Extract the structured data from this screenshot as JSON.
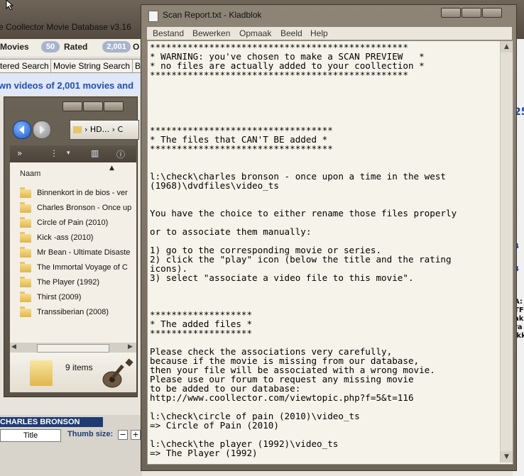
{
  "background_app": {
    "title": "e Coollector Movie Database  v3.16",
    "stats": [
      {
        "label": "Movies",
        "count": "50"
      },
      {
        "label": "Rated",
        "count": "2,001"
      },
      {
        "label": "O"
      }
    ],
    "tabs": [
      "tered Search",
      "Movie String Search",
      "B"
    ],
    "banner_text": "wn videos of 2,001 movies and",
    "bottom_header": "CHARLES BRONSON",
    "title_field_value": "Title",
    "thumb_size_label": "Thumb size:",
    "thumb_minus": "−",
    "thumb_plus": "+",
    "right_strip": [
      "25",
      "4",
      "4",
      "A:",
      "TF",
      "aki",
      "ra",
      "ikk"
    ]
  },
  "explorer": {
    "address": "HD...",
    "address_chevron": "›",
    "address_next": "C",
    "column_header": "Naam",
    "items": [
      "Binnenkort in de bios - ver",
      "Charles Bronson - Once up",
      "Circle of Pain (2010)",
      "Kick -ass (2010)",
      "Mr Bean - Ultimate Disaste",
      "The Immortal Voyage of C",
      "The Player (1992)",
      "Thirst (2009)",
      "Transsiberian (2008)"
    ],
    "item_count": "9 items"
  },
  "notepad": {
    "title": "Scan Report.txt - Kladblok",
    "menu": [
      "Bestand",
      "Bewerken",
      "Opmaak",
      "Beeld",
      "Help"
    ],
    "content": "************************************************\n* WARNING: you've chosen to make a SCAN PREVIEW   *\n* no files are actually added to your coollection *\n************************************************\n\n\n\n\n\n**********************************\n* The files that CAN'T BE added *\n**********************************\n\n\nl:\\check\\charles bronson - once upon a time in the west\n(1968)\\dvdfiles\\video_ts\n\n\nYou have the choice to either rename those files properly\n\nor to associate them manually:\n\n1) go to the corresponding movie or series.\n2) click the \"play\" icon (below the title and the rating\nicons).\n3) select \"associate a video file to this movie\".\n\n\n\n*******************\n* The added files *\n*******************\n\nPlease check the associations very carefully,\nbecause if the movie is missing from our database,\nthen your file will be associated with a wrong movie.\nPlease use our forum to request any missing movie\nto be added to our database:\nhttp://www.coollector.com/viewtopic.php?f=5&t=116\n\nl:\\check\\circle of pain (2010)\\video_ts\n=> Circle of Pain (2010)\n\nl:\\check\\the player (1992)\\video_ts\n=> The Player (1992)",
    "scroll_up": "▲",
    "scroll_down": "▼"
  },
  "colors": {
    "notepad_bg": "#f6f3ea",
    "bg_blue_text": "#1f4fb2",
    "charles_bar": "#1f3b74"
  }
}
